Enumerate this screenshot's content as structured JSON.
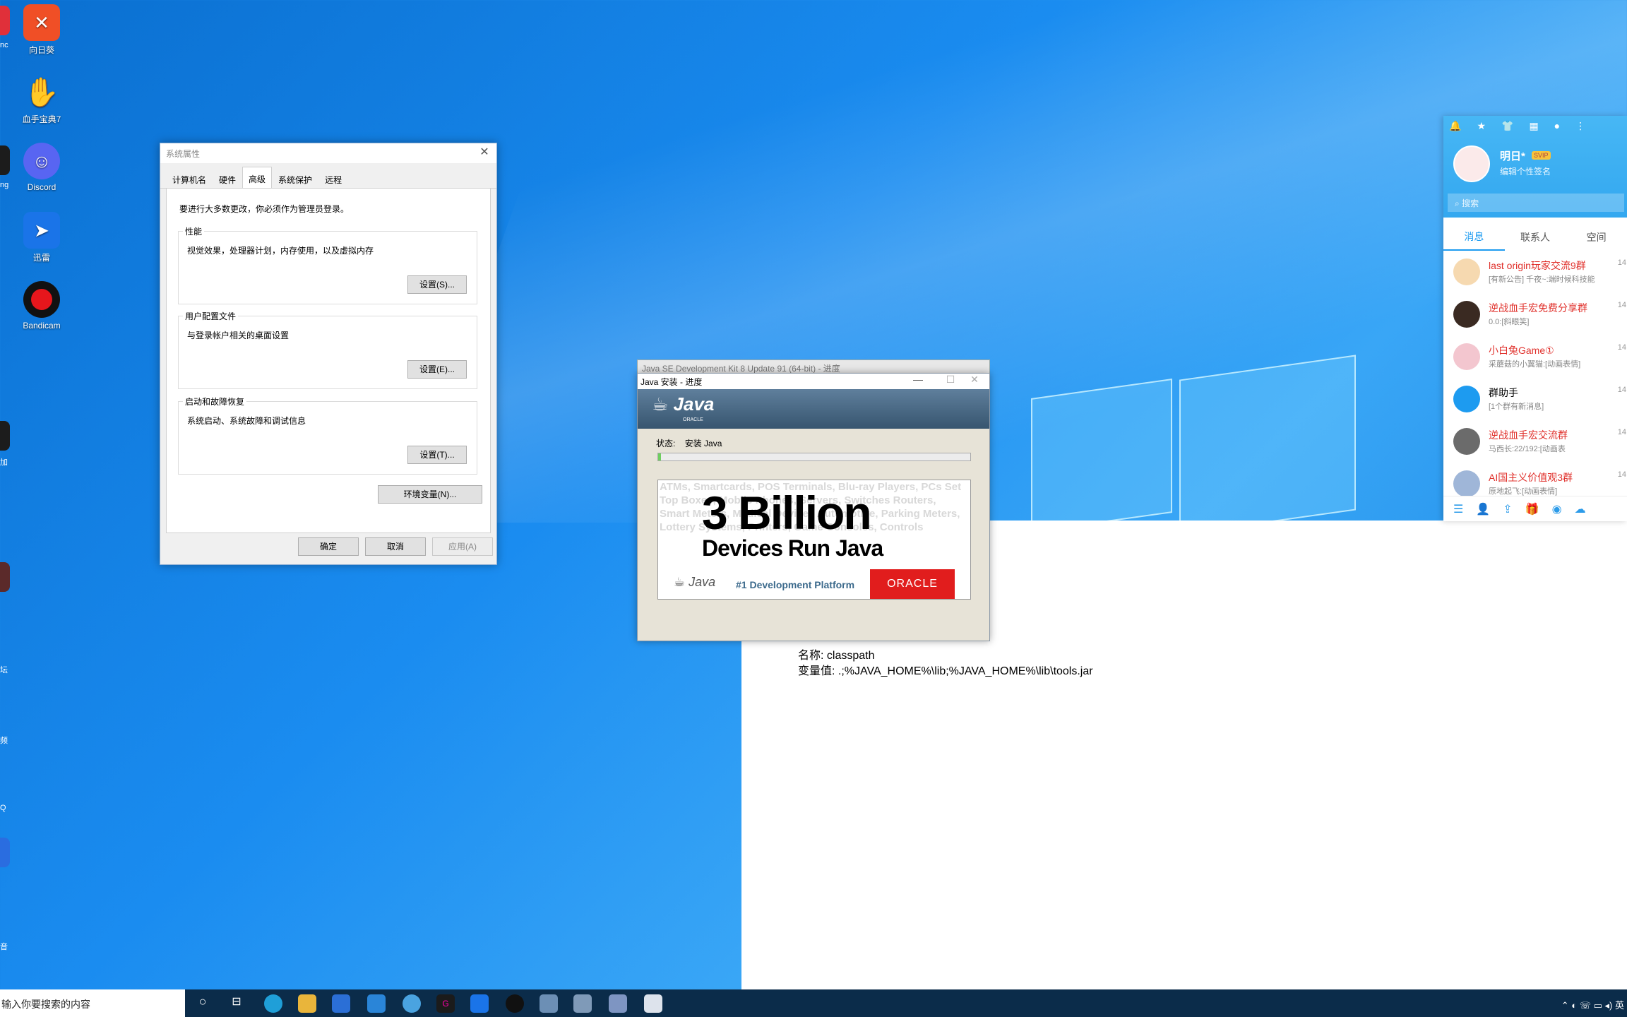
{
  "desktop": {
    "icons": [
      {
        "label": "向日葵"
      },
      {
        "label": "血手宝典7"
      },
      {
        "label": "Discord"
      },
      {
        "label": "迅雷"
      },
      {
        "label": "Bandicam"
      }
    ],
    "edge_labels": {
      "a": "nc",
      "b": "ng",
      "c": "加",
      "d": "坛",
      "e": "频",
      "f": "Q",
      "g": "音"
    }
  },
  "sysprops": {
    "title": "系统属性",
    "tabs": [
      "计算机名",
      "硬件",
      "高级",
      "系统保护",
      "远程"
    ],
    "notice": "要进行大多数更改，你必须作为管理员登录。",
    "perf_title": "性能",
    "perf_desc": "视觉效果，处理器计划，内存使用，以及虚拟内存",
    "perf_btn": "设置(S)...",
    "profile_title": "用户配置文件",
    "profile_desc": "与登录帐户相关的桌面设置",
    "profile_btn": "设置(E)...",
    "startup_title": "启动和故障恢复",
    "startup_desc": "系统启动、系统故障和调试信息",
    "startup_btn": "设置(T)...",
    "env_btn": "环境变量(N)...",
    "ok": "确定",
    "cancel": "取消",
    "apply": "应用(A)"
  },
  "java": {
    "back_title": "Java SE Development Kit 8 Update 91 (64-bit) - 进度",
    "title": "Java 安装 - 进度",
    "logo": "Java",
    "logo_sub": "ORACLE",
    "status_label": "状态:",
    "status_value": "安装 Java",
    "progress": 0.01,
    "banner_bg": "ATMs, Smartcards, POS Terminals, Blu-ray Players, PCs Set Top Boxes, Mobile Phones, Servers, Switches Routers, Smart Meters, Medical Devices Automotive, Parking Meters, Lottery Systems, Printers, Game Consoles, Controls",
    "big1": "3 Billion",
    "big2": "Devices Run Java",
    "banner_java": "Java",
    "platform": "#1 Development Platform",
    "oracle": "ORACLE"
  },
  "doc": {
    "name_line": "名称:   classpath",
    "value_line": "变量值:  .;%JAVA_HOME%\\lib;%JAVA_HOME%\\lib\\tools.jar"
  },
  "qq": {
    "name": "明日*",
    "svip": "SVIP",
    "sign": "编辑个性签名",
    "search_placeholder": "搜索",
    "tabs": [
      "消息",
      "联系人",
      "空间"
    ],
    "items": [
      {
        "title": "last origin玩家交流9群",
        "sub": "[有新公告] 千夜~:端时候科技能",
        "time": "14:",
        "red": true
      },
      {
        "title": "逆战血手宏免费分享群",
        "sub": "0.0:[斜眼笑]",
        "time": "14:",
        "red": true
      },
      {
        "title": "小白兔Game①",
        "sub": "采蘑菇的小翼猫:[动画表情]",
        "time": "14:",
        "red": true
      },
      {
        "title": "群助手",
        "sub": "[1个群有新消息]",
        "time": "14:",
        "red": false
      },
      {
        "title": "逆战血手宏交流群",
        "sub": "马西长:22/192:[动画表",
        "time": "14:",
        "red": true
      },
      {
        "title": "AI国主义价值观3群",
        "sub": "原地起飞:[动画表情]",
        "time": "14:",
        "red": true
      }
    ]
  },
  "taskbar": {
    "search_placeholder": "输入你要搜索的内容",
    "tray_text": "英"
  },
  "colors": {
    "accent": "#1d9bf0",
    "oracle_red": "#e11d1d",
    "progress_green": "#6fce5f"
  }
}
